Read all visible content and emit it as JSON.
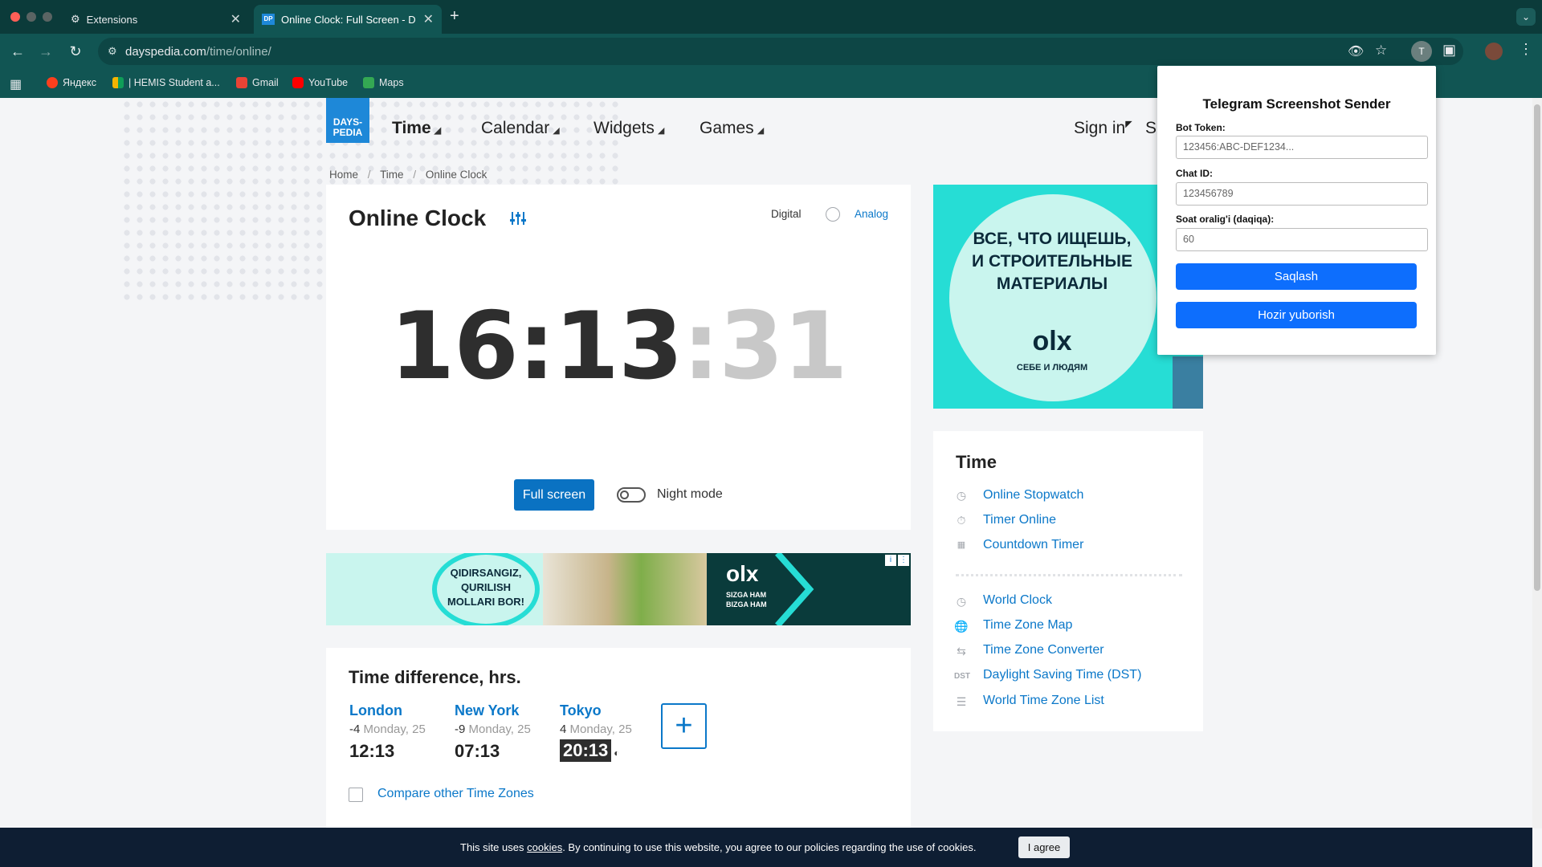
{
  "browser": {
    "tabs": [
      {
        "title": "Extensions"
      },
      {
        "title": "Online Clock: Full Screen - D"
      }
    ],
    "url_host": "dayspedia.com",
    "url_path": "/time/online/",
    "profile_initial": "T",
    "bookmarks": [
      "Яндекс",
      "| HEMIS Student a...",
      "Gmail",
      "YouTube",
      "Maps"
    ]
  },
  "site": {
    "logo_line1": "DAYS-",
    "logo_line2": "PEDIA",
    "menu": [
      "Time",
      "Calendar",
      "Widgets",
      "Games"
    ],
    "sign_in": "Sign in",
    "sign_in_partial": "S",
    "breadcrumb": [
      "Home",
      "Time",
      "Online Clock"
    ]
  },
  "clock": {
    "title": "Online Clock",
    "mode_digital": "Digital",
    "mode_analog": "Analog",
    "hours": "16",
    "minutes": "13",
    "seconds": "31",
    "fullscreen_label": "Full screen",
    "night_mode_label": "Night mode"
  },
  "ad_top": {
    "text": "ВСЕ, ЧТО ИЩЕШЬ, И СТРОИТЕЛЬНЫЕ МАТЕРИАЛЫ",
    "brand": "olx",
    "tagline": "СЕБЕ И ЛЮДЯМ"
  },
  "ad_banner": {
    "text": "QIDIRSANGIZ, QURILISH MOLLARI BOR!",
    "brand": "olx",
    "tagline1": "SIZGA HAM",
    "tagline2": "BIZGA HAM"
  },
  "time_diff": {
    "title": "Time difference, hrs.",
    "cities": [
      {
        "name": "London",
        "offset": "-4",
        "date": "Monday, 25",
        "time": "12:13"
      },
      {
        "name": "New York",
        "offset": "-9",
        "date": "Monday, 25",
        "time": "07:13"
      },
      {
        "name": "Tokyo",
        "offset": "4",
        "date": "Monday, 25",
        "time": "20:13"
      }
    ],
    "add_label": "+",
    "compare_label": "Compare other Time Zones"
  },
  "sidebar": {
    "title": "Time",
    "group1": [
      "Online Stopwatch",
      "Timer Online",
      "Countdown Timer"
    ],
    "group2": [
      "World Clock",
      "Time Zone Map",
      "Time Zone Converter",
      "Daylight Saving Time (DST)",
      "World Time Zone List"
    ],
    "dst_badge": "DST"
  },
  "popup": {
    "title": "Telegram Screenshot Sender",
    "bot_token_label": "Bot Token:",
    "bot_token_placeholder": "123456:ABC-DEF1234...",
    "chat_id_label": "Chat ID:",
    "chat_id_placeholder": "123456789",
    "interval_label": "Soat oralig'i (daqiqa):",
    "interval_value": "60",
    "save_label": "Saqlash",
    "send_now_label": "Hozir yuborish"
  },
  "cookie": {
    "text_before": "This site uses",
    "link": "cookies",
    "text_after": ". By continuing to use this website, you agree to our policies regarding the use of cookies.",
    "button": "I agree"
  },
  "colors": {
    "browser_dark": "#0b3b3a",
    "browser_toolbar": "#115553",
    "link_blue": "#0b78c9",
    "button_blue": "#0a72c2",
    "popup_button": "#0d6efd",
    "cookie_bar": "#0e1e33",
    "ad_teal": "#26ddd5"
  }
}
